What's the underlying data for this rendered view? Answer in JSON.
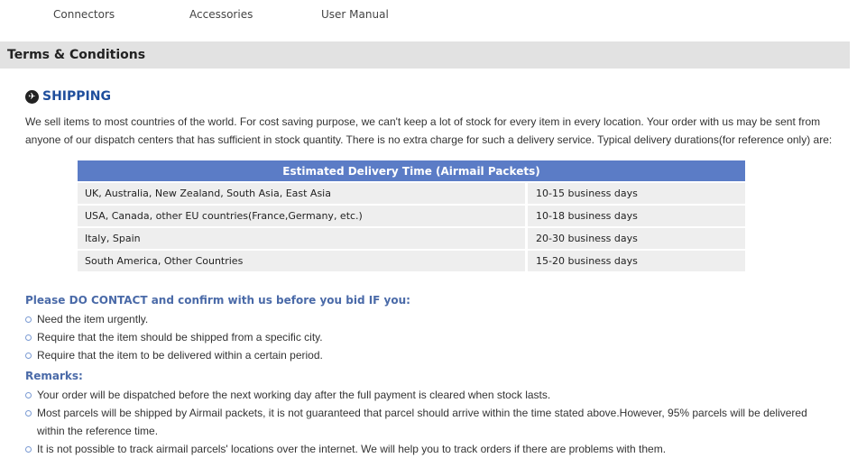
{
  "nav": {
    "items": [
      "Connectors",
      "Accessories",
      "User Manual"
    ]
  },
  "terms": {
    "title": "Terms & Conditions"
  },
  "shipping": {
    "icon": "airplane-icon",
    "title": "SHIPPING",
    "intro": "We sell items to most countries of the world. For cost saving purpose, we can't keep a lot of stock for every item in every location. Your order with us may be sent from anyone of our dispatch centers that has sufficient in stock quantity. There is no extra charge for such a delivery service. Typical delivery durations(for reference only) are:",
    "table": {
      "header": "Estimated Delivery Time (Airmail Packets)",
      "rows": [
        {
          "region": "UK, Australia, New Zealand, South Asia, East Asia",
          "time": "10-15 business days"
        },
        {
          "region": "USA, Canada, other EU countries(France,Germany, etc.)",
          "time": "10-18 business days"
        },
        {
          "region": "Italy, Spain",
          "time": "20-30 business days"
        },
        {
          "region": "South America, Other Countries",
          "time": "15-20 business days"
        }
      ]
    },
    "contact": {
      "heading": "Please DO CONTACT and confirm with us before you bid IF you:",
      "items": [
        "Need the item urgently.",
        "Require that the item should be shipped from a specific city.",
        "Require that the item to be delivered within a certain period."
      ]
    },
    "remarks": {
      "heading": "Remarks:",
      "items": [
        "Your order will be dispatched before the next working day after the full payment is cleared when stock lasts.",
        "Most parcels will be shipped by Airmail packets, it is not guaranteed that parcel should arrive within the time stated above.However, 95% parcels will be delivered within the reference time.",
        "It is not possible to track airmail parcels' locations over the internet. We will help you to track orders if there are problems with them."
      ]
    }
  },
  "colors": {
    "table_header": "#5b7cc6",
    "heading_blue": "#1f4e9c",
    "subhead_blue": "#4a6aa8",
    "bar_gray": "#e2e2e2"
  }
}
